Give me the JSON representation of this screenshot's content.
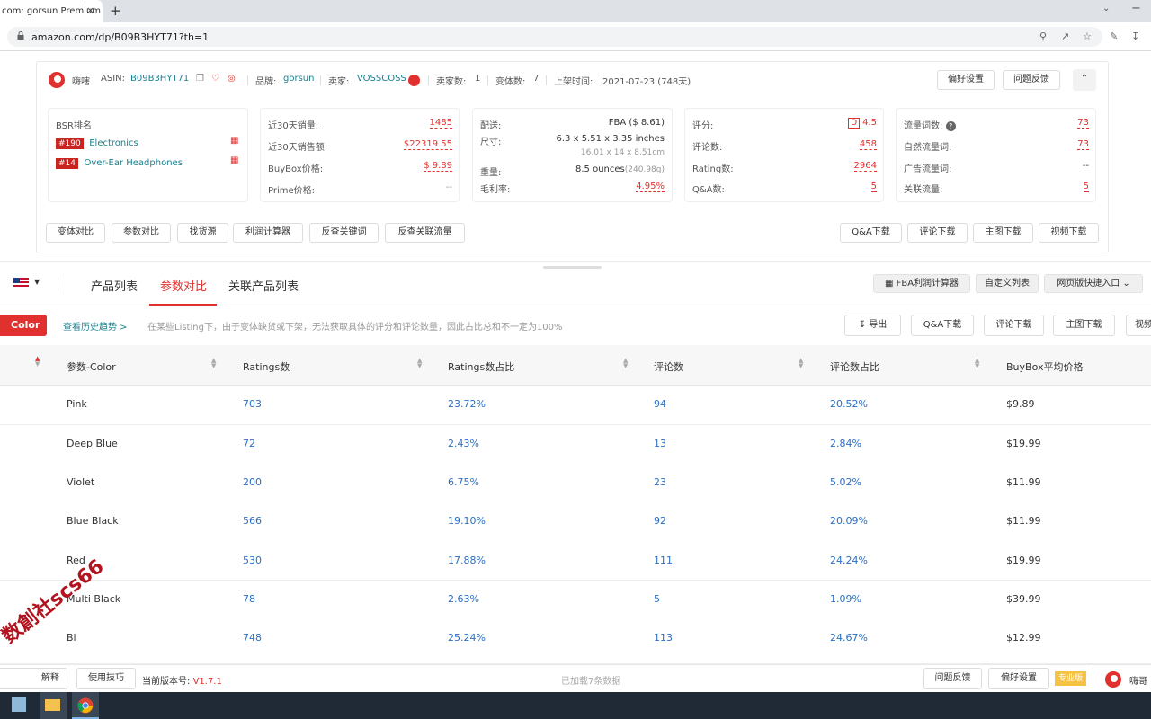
{
  "browser": {
    "tab_title": "com: gorsun Premium",
    "close_glyph": "×",
    "new_tab_glyph": "+",
    "url": "amazon.com/dp/B09B3HYT71?th=1"
  },
  "panel": {
    "brand_name": "嗨嗐",
    "asin_label": "ASIN:",
    "asin": "B09B3HYT71",
    "brand_label": "品牌:",
    "brand": "gorsun",
    "seller_label": "卖家:",
    "seller": "VOSSCOSS",
    "seller_count_label": "卖家数:",
    "seller_count": "1",
    "variant_label": "变体数:",
    "variant_count": "7",
    "listed_label": "上架时间:",
    "listed": "2021-07-23 (748天)",
    "pref_button": "偏好设置",
    "feedback_button": "问题反馈",
    "bsr": {
      "title": "BSR排名",
      "ranks": [
        {
          "rank": "#190",
          "category": "Electronics"
        },
        {
          "rank": "#14",
          "category": "Over-Ear Headphones"
        }
      ]
    },
    "sales": [
      {
        "label": "近30天销量:",
        "value": "1485"
      },
      {
        "label": "近30天销售额:",
        "value": "$22319.55"
      },
      {
        "label": "BuyBox价格:",
        "value": "$ 9.89"
      },
      {
        "label": "Prime价格:",
        "value": "--"
      }
    ],
    "ship": {
      "delivery_label": "配送:",
      "delivery": "FBA ($ 8.61)",
      "size_label": "尺寸:",
      "size": "6.3 x 5.51 x 3.35 inches",
      "size_cm": "16.01 x 14 x 8.51cm",
      "weight_label": "重量:",
      "weight": "8.5 ounces",
      "weight_g": "(240.98g)",
      "margin_label": "毛利率:",
      "margin": "4.95%"
    },
    "rating": {
      "score_label": "评分:",
      "grade": "D",
      "score": "4.5",
      "reviews_label": "评论数:",
      "reviews": "458",
      "ratings_label": "Rating数:",
      "ratings": "2964",
      "qa_label": "Q&A数:",
      "qa": "5"
    },
    "traffic": {
      "kw_label": "流量词数:",
      "kw": "73",
      "organic_label": "自然流量词:",
      "organic": "73",
      "ad_label": "广告流量词:",
      "ad": "--",
      "related_label": "关联流量:",
      "related": "5"
    },
    "bottom_buttons": [
      "变体对比",
      "参数对比",
      "找货源",
      "利润计算器",
      "反查关键词",
      "反查关联流量"
    ],
    "download_buttons": [
      "Q&A下载",
      "评论下载",
      "主图下载",
      "视频下载"
    ]
  },
  "lower": {
    "tabs": [
      "产品列表",
      "参数对比",
      "关联产品列表"
    ],
    "right_buttons": [
      "FBA利润计算器",
      "自定义列表",
      "网页版快捷入口"
    ],
    "color_button": "Color",
    "history_link": "查看历史趋势 >",
    "note": "在某些Listing下，由于变体缺货或下架，无法获取具体的评分和评论数量，因此占比总和不一定为100%",
    "action_buttons": [
      "导出",
      "Q&A下载",
      "评论下载",
      "主图下载",
      "视频"
    ],
    "columns": [
      "参数-Color",
      "Ratings数",
      "Ratings数占比",
      "评论数",
      "评论数占比",
      "BuyBox平均价格"
    ],
    "rows": [
      [
        "Pink",
        "703",
        "23.72%",
        "94",
        "20.52%",
        "$9.89"
      ],
      [
        "Deep Blue",
        "72",
        "2.43%",
        "13",
        "2.84%",
        "$19.99"
      ],
      [
        "Violet",
        "200",
        "6.75%",
        "23",
        "5.02%",
        "$11.99"
      ],
      [
        "Blue Black",
        "566",
        "19.10%",
        "92",
        "20.09%",
        "$11.99"
      ],
      [
        "Red",
        "530",
        "17.88%",
        "111",
        "24.24%",
        "$19.99"
      ],
      [
        "Multi Black",
        "78",
        "2.63%",
        "5",
        "1.09%",
        "$39.99"
      ],
      [
        "Bl",
        "748",
        "25.24%",
        "113",
        "24.67%",
        "$12.99"
      ]
    ]
  },
  "footer": {
    "left_button": "解释",
    "tips_button": "使用技巧",
    "version_label": "当前版本号:",
    "version": "V1.7.1",
    "loaded": "已加载7条数据",
    "feedback": "问题反馈",
    "prefs": "偏好设置",
    "pro_badge": "专业版",
    "brand": "嗨哥"
  },
  "watermark": "数創社scs66"
}
